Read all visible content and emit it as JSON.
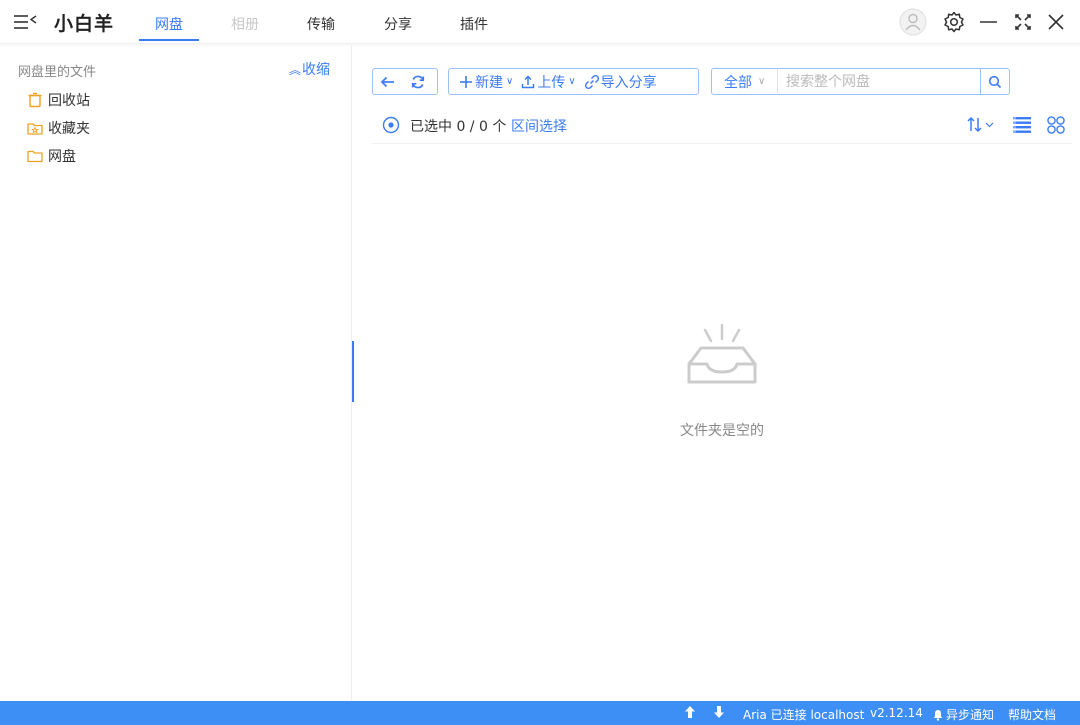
{
  "app": {
    "name": "小白羊",
    "tabs": [
      {
        "label": "网盘"
      },
      {
        "label": "相册"
      },
      {
        "label": "传输"
      },
      {
        "label": "分享"
      },
      {
        "label": "插件"
      }
    ],
    "active_tab": "网盘",
    "accent_color": "#3b7cf4",
    "icons": [
      "menu-icon",
      "avatar",
      "gear-icon",
      "minimize-icon",
      "fullscreen-icon",
      "close-icon"
    ]
  },
  "sidebar": {
    "header": "网盘里的文件",
    "collapse_label": "收缩",
    "items": [
      {
        "label": "回收站",
        "icon": "trash-icon"
      },
      {
        "label": "收藏夹",
        "icon": "favorite-folder-icon"
      },
      {
        "label": "网盘",
        "icon": "folder-icon"
      }
    ]
  },
  "toolbar": {
    "new_label": "新建",
    "upload_label": "上传",
    "import_share_label": "导入分享",
    "filter_label": "全部",
    "search_placeholder": "搜索整个网盘"
  },
  "selection": {
    "text": "已选中 0 / 0 个",
    "range_select_label": "区间选择"
  },
  "empty": {
    "message": "文件夹是空的"
  },
  "statusbar": {
    "aria_status": "Aria 已连接 localhost",
    "version": "v2.12.14",
    "async_notify": "异步通知",
    "help_docs": "帮助文档",
    "color": "#3d8ef5"
  }
}
